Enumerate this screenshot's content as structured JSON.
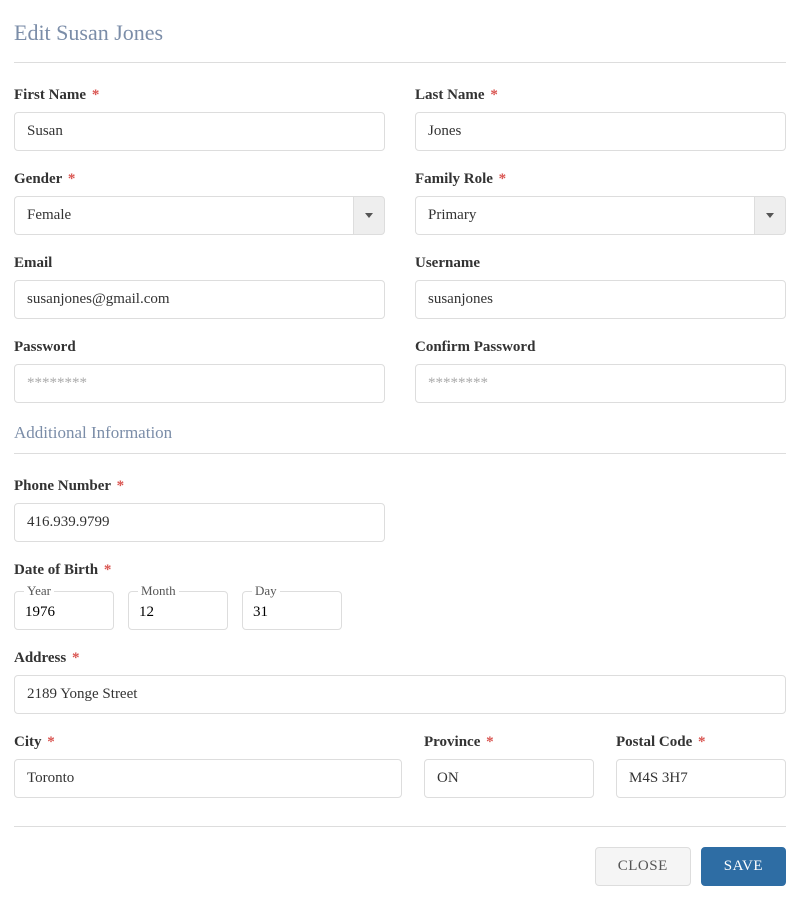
{
  "page_title": "Edit Susan Jones",
  "labels": {
    "first_name": "First Name",
    "last_name": "Last Name",
    "gender": "Gender",
    "family_role": "Family Role",
    "email": "Email",
    "username": "Username",
    "password": "Password",
    "confirm_password": "Confirm Password",
    "phone": "Phone Number",
    "dob": "Date of Birth",
    "dob_year": "Year",
    "dob_month": "Month",
    "dob_day": "Day",
    "address": "Address",
    "city": "City",
    "province": "Province",
    "postal": "Postal Code"
  },
  "section": {
    "additional": "Additional Information"
  },
  "values": {
    "first_name": "Susan",
    "last_name": "Jones",
    "gender": "Female",
    "family_role": "Primary",
    "email": "susanjones@gmail.com",
    "username": "susanjones",
    "password_placeholder": "********",
    "confirm_placeholder": "********",
    "phone": "416.939.9799",
    "dob_year": "1976",
    "dob_month": "12",
    "dob_day": "31",
    "address": "2189 Yonge Street",
    "city": "Toronto",
    "province": "ON",
    "postal": "M4S 3H7"
  },
  "buttons": {
    "close": "CLOSE",
    "save": "SAVE"
  },
  "marker": {
    "required": "*"
  }
}
